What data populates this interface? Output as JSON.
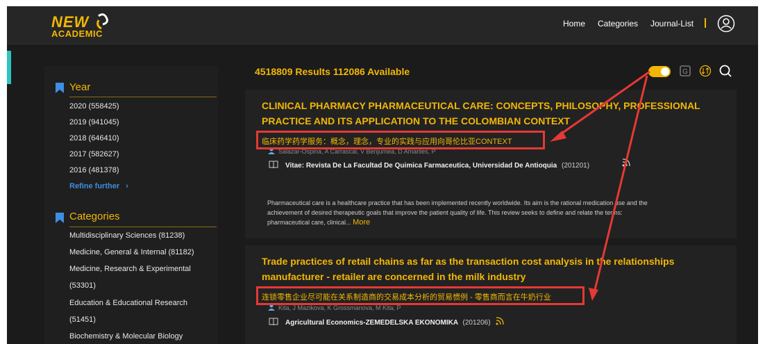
{
  "header": {
    "logo_new": "NEW",
    "logo_academic": "ACADEMIC",
    "nav": [
      "Home",
      "Categories",
      "Journal-List"
    ]
  },
  "sidebar": {
    "year_title": "Year",
    "years": [
      "2020 (558425)",
      "2019 (941045)",
      "2018 (646410)",
      "2017 (582627)",
      "2016 (481378)"
    ],
    "refine": "Refine further",
    "categories_title": "Categories",
    "categories": [
      "Multidisciplinary Sciences (81238)",
      "Medicine, General & Internal (81182)",
      "Medicine, Research & Experimental",
      "(53301)",
      "Education & Educational Research",
      "(51451)",
      "Biochemistry & Molecular Biology"
    ]
  },
  "results": {
    "count": "4518809 Results",
    "available": "112086 Available",
    "items": [
      {
        "title_line1": "CLINICAL PHARMACY PHARMACEUTICAL CARE: CONCEPTS, PHILOSOPHY, PROFESSIONAL",
        "title_line2": "PRACTICE AND ITS APPLICATION TO THE COLOMBIAN CONTEXT",
        "translation": "临床药学药学服务：概念，理念，专业的实践与应用向哥伦比亚CONTEXT",
        "authors": "Salazar-Ospina, A    Carrascal, V    Benjumea, D    Amariles, P",
        "journal": "Vitae: Revista De La Facultad De Quimica Farmaceutica, Universidad De Antioquia",
        "date": "(201201)",
        "abstract_line1": "Pharmaceutical care is a healthcare practice that has been implemented recently worldwide. Its aim is the rational medication use and the",
        "abstract_line2": "achievement of desired therapeutic goals that improve the patient quality of life. This review seeks to define and relate the terms:",
        "abstract_line3": "pharmaceutical care, clinical...",
        "more": "More"
      },
      {
        "title_line1": "Trade practices of retail chains as far as the transaction cost analysis in the relationships",
        "title_line2": "manufacturer - retailer are concerned in the milk industry",
        "translation": "连锁零售企业尽可能在关系制造商的交易成本分析的贸易惯例 - 零售商而言在牛奶行业",
        "authors": "Kita, J    Mazikova, K    Grossmanova, M    Kita, P",
        "journal": "Agricultural Economics-ZEMEDELSKA EKONOMIKA",
        "date": "(201206)"
      }
    ]
  },
  "colors": {
    "accent": "#f2b705",
    "annotation": "#e53935",
    "tab": "#2ec4c4",
    "link": "#3d8fe0"
  }
}
